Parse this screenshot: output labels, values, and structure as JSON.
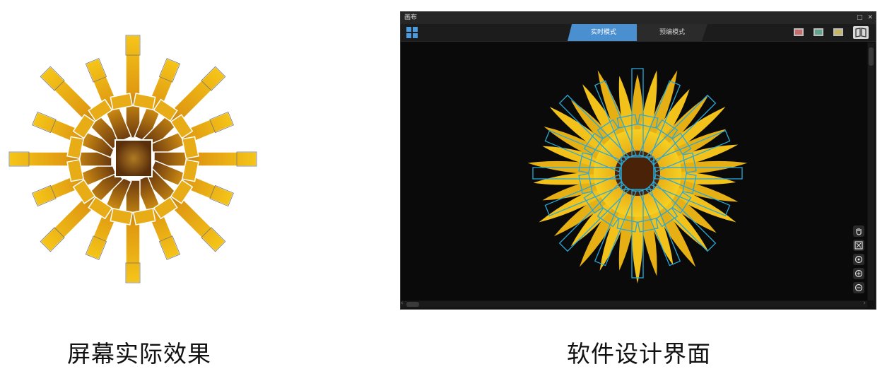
{
  "captions": {
    "left": "屏幕实际效果",
    "right": "软件设计界面"
  },
  "app": {
    "window_title": "画布",
    "window_controls": [
      "□",
      "✕"
    ],
    "tabs": [
      {
        "label": "实时模式",
        "active": true
      },
      {
        "label": "预编模式",
        "active": false
      }
    ],
    "layer_buttons": [
      {
        "name": "red-layer",
        "color": "#c96b6b"
      },
      {
        "name": "green-layer",
        "color": "#5fa38d"
      },
      {
        "name": "yellow-layer",
        "color": "#c9b45f"
      }
    ],
    "side_tools": [
      "hand-icon",
      "fit-icon",
      "center-icon",
      "zoom-in-icon",
      "zoom-out-icon"
    ]
  },
  "colors": {
    "accent": "#4a8fd0",
    "outline": "#29a8d8",
    "petal": "#f2c21b",
    "petal_dark": "#e0a10f",
    "center": "#6b3a10"
  }
}
